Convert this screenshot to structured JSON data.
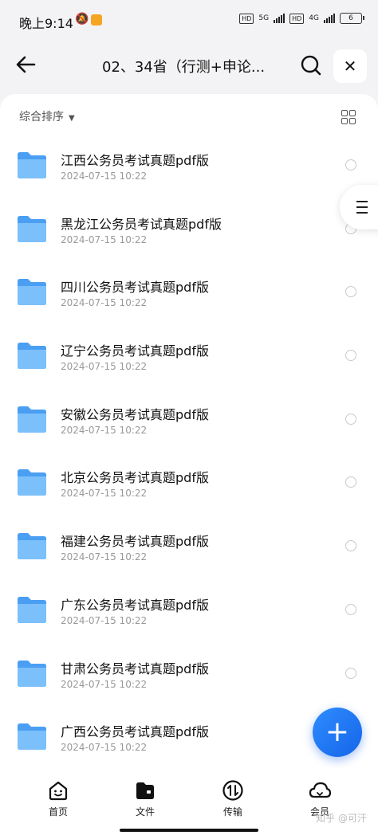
{
  "status": {
    "time": "晚上9:14",
    "net1": "5G",
    "net2": "4G",
    "hd": "HD",
    "battery": "6"
  },
  "header": {
    "title": "02、34省（行测+申论...",
    "back_icon": "arrow-left-icon",
    "search_icon": "search-icon",
    "close_icon": "close-icon"
  },
  "toolbar": {
    "sort_label": "综合排序"
  },
  "files": [
    {
      "name": "江西公务员考试真题pdf版",
      "date": "2024-07-15 10:22"
    },
    {
      "name": "黑龙江公务员考试真题pdf版",
      "date": "2024-07-15 10:22"
    },
    {
      "name": "四川公务员考试真题pdf版",
      "date": "2024-07-15 10:22"
    },
    {
      "name": "辽宁公务员考试真题pdf版",
      "date": "2024-07-15 10:22"
    },
    {
      "name": "安徽公务员考试真题pdf版",
      "date": "2024-07-15 10:22"
    },
    {
      "name": "北京公务员考试真题pdf版",
      "date": "2024-07-15 10:22"
    },
    {
      "name": "福建公务员考试真题pdf版",
      "date": "2024-07-15 10:22"
    },
    {
      "name": "广东公务员考试真题pdf版",
      "date": "2024-07-15 10:22"
    },
    {
      "name": "甘肃公务员考试真题pdf版",
      "date": "2024-07-15 10:22"
    },
    {
      "name": "广西公务员考试真题pdf版",
      "date": "2024-07-15 10:22"
    }
  ],
  "tabbar": {
    "home": "首页",
    "files": "文件",
    "transfer": "传输",
    "member": "会员"
  },
  "watermark": "知乎 @可汗",
  "colors": {
    "accent": "#1f6fee",
    "folder": "#5aa9f5"
  }
}
